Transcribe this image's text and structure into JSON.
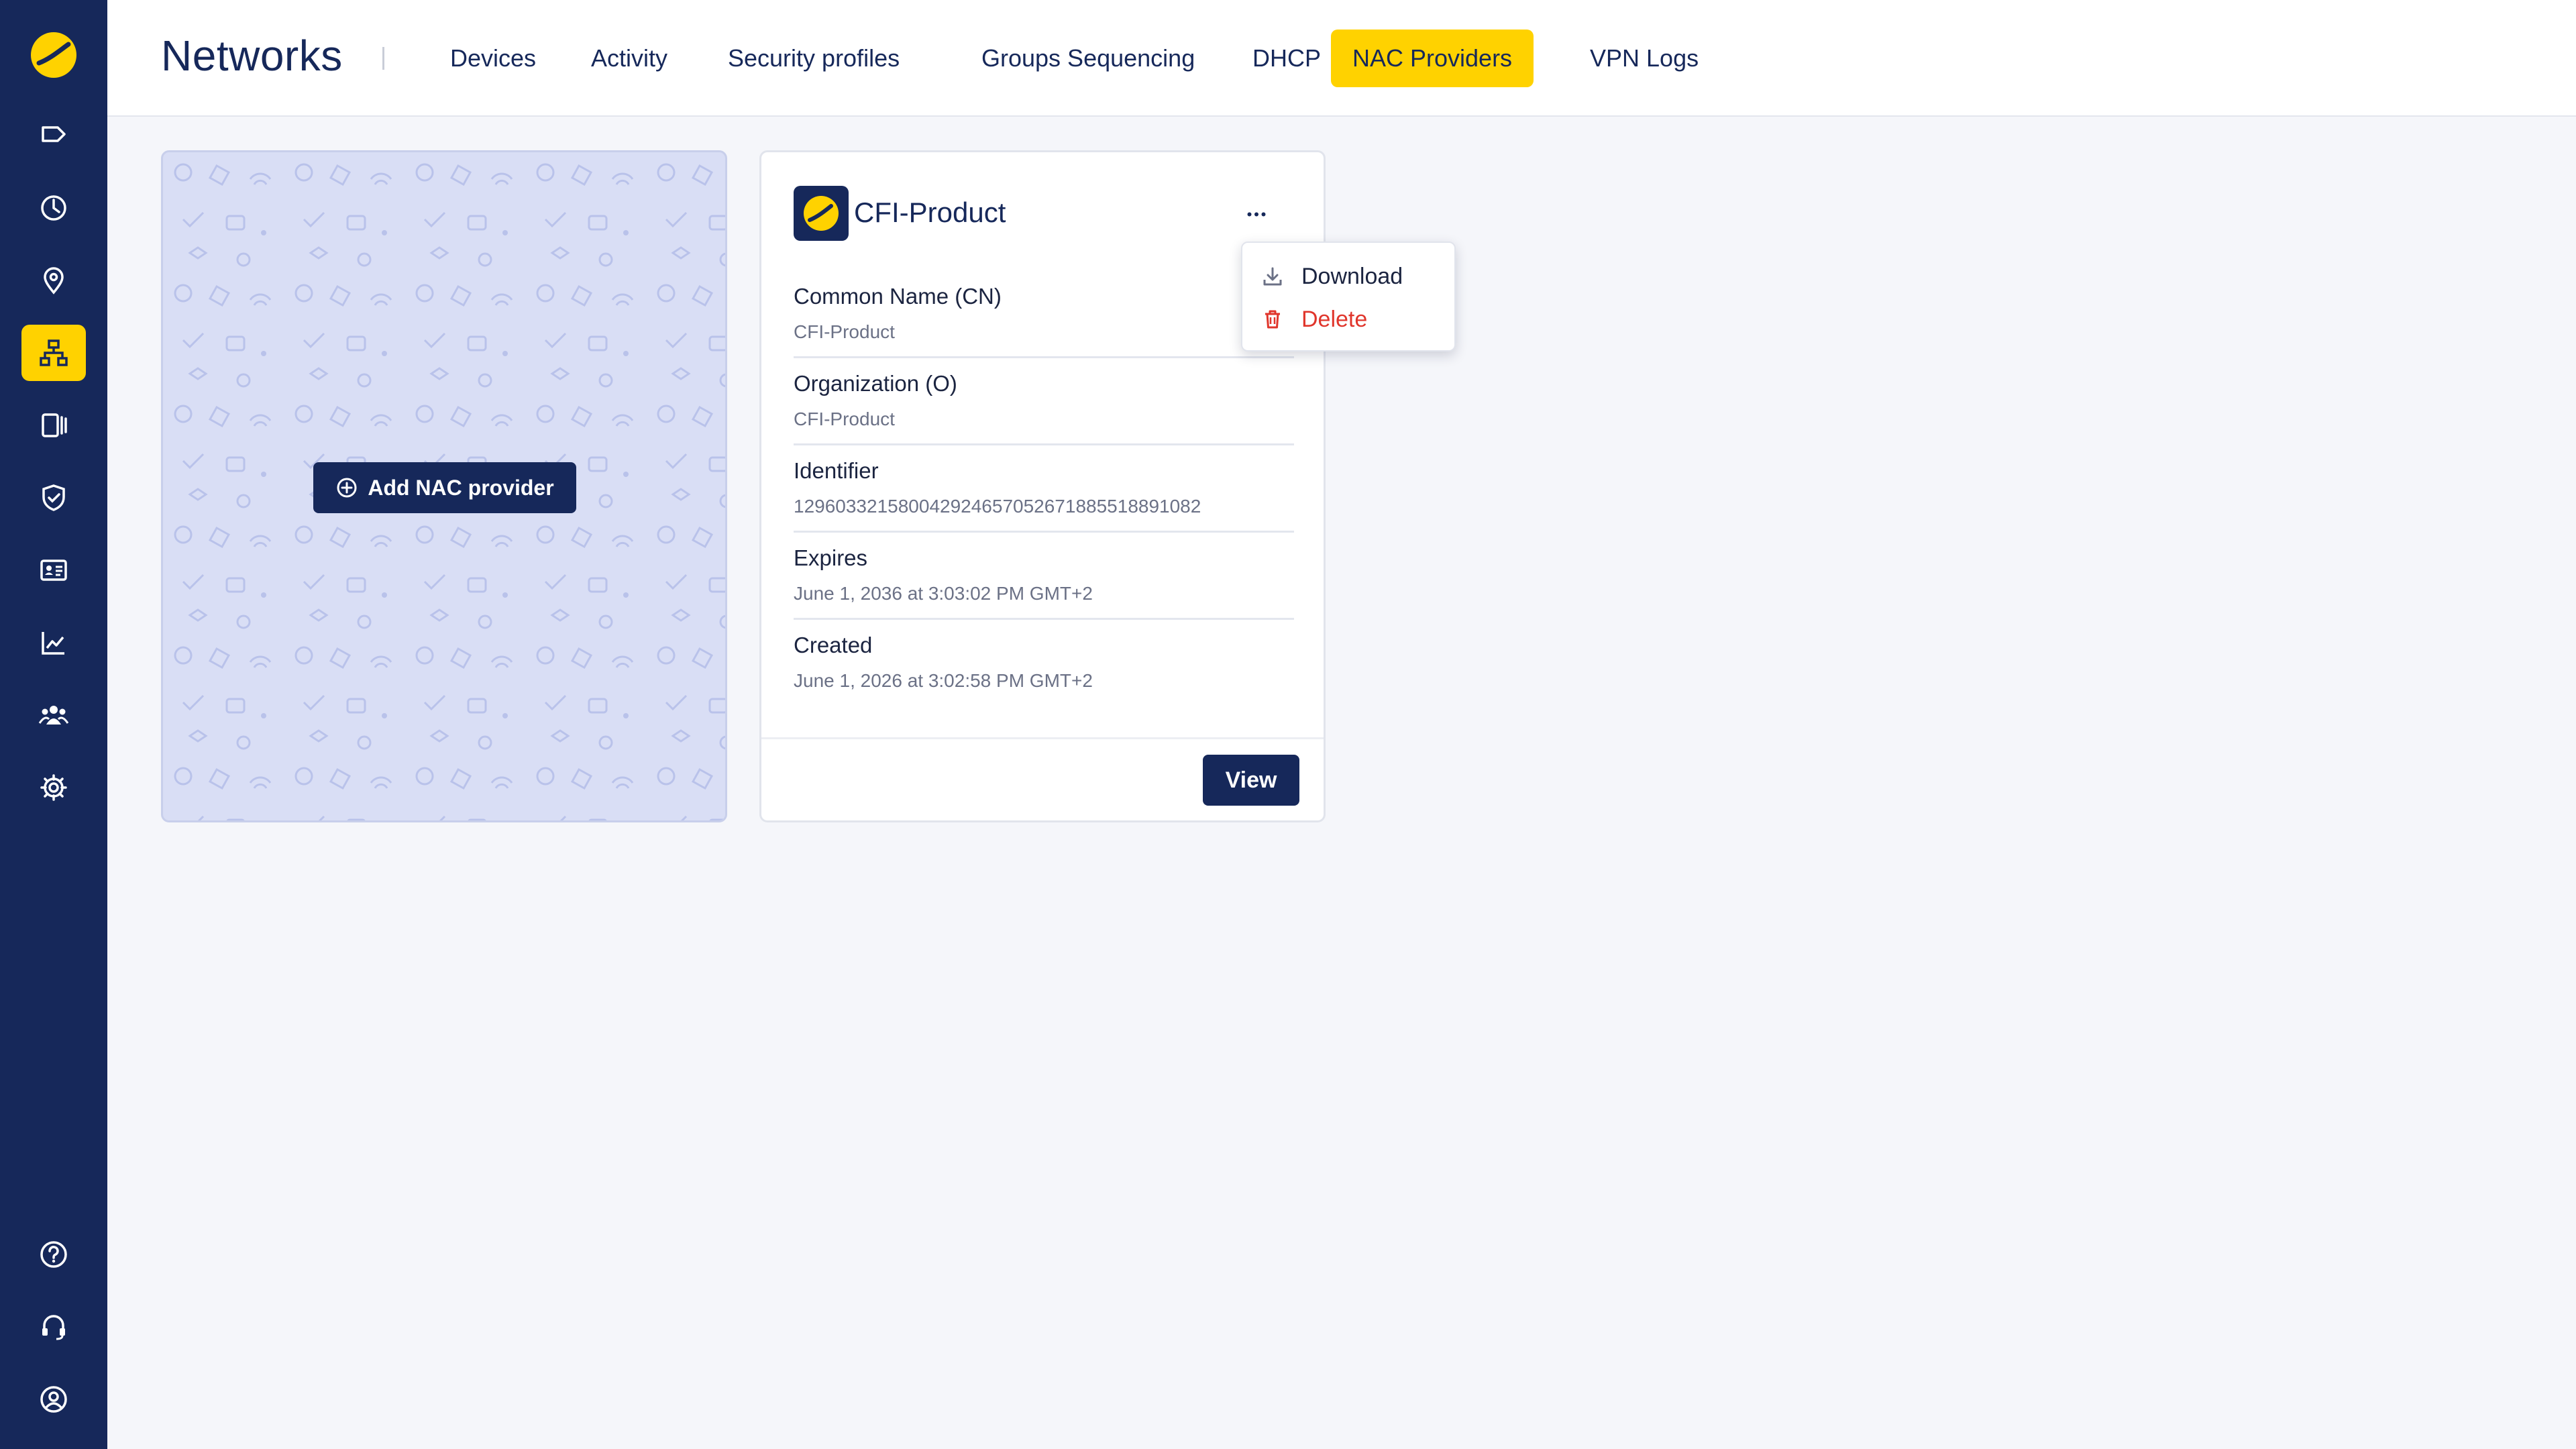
{
  "header": {
    "title": "Networks",
    "tabs": [
      {
        "label": "Devices",
        "active": false
      },
      {
        "label": "Activity",
        "active": false
      },
      {
        "label": "Security profiles",
        "active": false
      },
      {
        "label": "Groups Sequencing",
        "active": false
      },
      {
        "label": "DHCP",
        "active": false
      },
      {
        "label": "NAC Providers",
        "active": true
      },
      {
        "label": "VPN Logs",
        "active": false
      }
    ]
  },
  "sidebar": {
    "items": [
      {
        "icon": "tag-icon",
        "active": false
      },
      {
        "icon": "dashboard-gauge-icon",
        "active": false
      },
      {
        "icon": "location-pin-icon",
        "active": false
      },
      {
        "icon": "network-icon",
        "active": true
      },
      {
        "icon": "devices-icon",
        "active": false
      },
      {
        "icon": "shield-check-icon",
        "active": false
      },
      {
        "icon": "id-card-icon",
        "active": false
      },
      {
        "icon": "analytics-chart-icon",
        "active": false
      },
      {
        "icon": "users-icon",
        "active": false
      },
      {
        "icon": "settings-gear-icon",
        "active": false
      }
    ],
    "bottom_items": [
      {
        "icon": "help-icon"
      },
      {
        "icon": "support-headset-icon"
      },
      {
        "icon": "account-icon"
      }
    ],
    "accent_color": "#ffd200",
    "background_color": "#16285a"
  },
  "add_card": {
    "button_label": "Add NAC provider"
  },
  "provider_card": {
    "name": "CFI-Product",
    "fields": [
      {
        "label": "Common Name (CN)",
        "value": "CFI-Product"
      },
      {
        "label": "Organization (O)",
        "value": "CFI-Product"
      },
      {
        "label": "Identifier",
        "value": "129603321580042924657052671885518891082"
      },
      {
        "label": "Expires",
        "value": "June 1, 2036 at 3:03:02 PM GMT+2"
      },
      {
        "label": "Created",
        "value": "June 1, 2026 at 3:02:58 PM GMT+2"
      }
    ],
    "view_label": "View"
  },
  "context_menu": {
    "download_label": "Download",
    "delete_label": "Delete",
    "delete_color": "#e0352b"
  }
}
